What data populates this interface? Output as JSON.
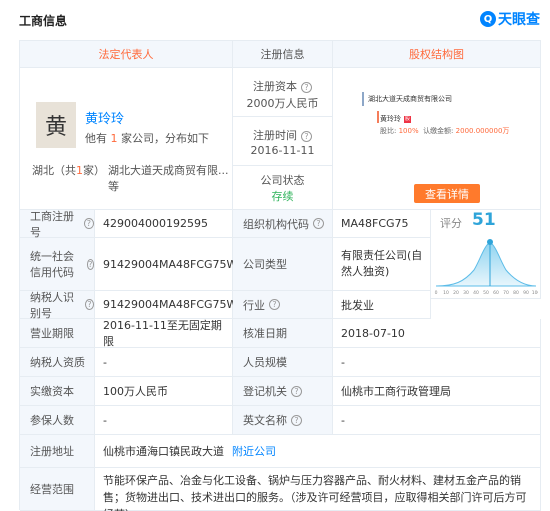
{
  "header": {
    "title": "工商信息",
    "logo_text": "天眼查",
    "logo_badge": "Q"
  },
  "columns": {
    "legal_rep": "法定代表人",
    "registration": "注册信息",
    "equity": "股权结构图"
  },
  "legal_rep": {
    "avatar_char": "黄",
    "name": "黄玲玲",
    "sub_prefix": "他有",
    "sub_count": "1",
    "sub_suffix": "家公司，分布如下",
    "province": "湖北",
    "province_prefix": "（共",
    "province_count": "1",
    "province_suffix": "家）",
    "companies": "湖北大道天成商贸有限...等"
  },
  "registration": {
    "capital_label": "注册资本",
    "capital_value": "2000万人民币",
    "time_label": "注册时间",
    "time_value": "2016-11-11",
    "status_label": "公司状态",
    "status_value": "存续"
  },
  "equity": {
    "company": "湖北大道天成商贸有限公司",
    "person": "黄玲玲",
    "person_mark": "股",
    "ratio_label": "股比:",
    "ratio_value": "100%",
    "amount_label": "认缴金额:",
    "amount_value": "2000.000000万",
    "button": "查看详情"
  },
  "score": {
    "label": "评分",
    "value": "51",
    "ticks": [
      "0",
      "10",
      "20",
      "30",
      "40",
      "50",
      "60",
      "70",
      "80",
      "90",
      "100"
    ]
  },
  "rows": [
    {
      "l1": "工商注册号",
      "q1": true,
      "v1": "429004000192595",
      "l2": "组织机构代码",
      "q2": true,
      "v2": "MA48FCG75"
    },
    {
      "l1": "统一社会信用代码",
      "q1": true,
      "v1": "91429004MA48FCG75W",
      "l2": "公司类型",
      "q2": false,
      "v2": "有限责任公司(自然人独资)"
    },
    {
      "l1": "纳税人识别号",
      "q1": true,
      "v1": "91429004MA48FCG75W",
      "l2": "行业",
      "q2": true,
      "v2": "批发业"
    },
    {
      "l1": "营业期限",
      "q1": false,
      "v1": "2016-11-11至无固定期限",
      "l2": "核准日期",
      "q2": false,
      "v2": "2018-07-10"
    },
    {
      "l1": "纳税人资质",
      "q1": false,
      "v1": "-",
      "l2": "人员规模",
      "q2": false,
      "v2": "-"
    },
    {
      "l1": "实缴资本",
      "q1": false,
      "v1": "100万人民币",
      "l2": "登记机关",
      "q2": true,
      "v2": "仙桃市工商行政管理局"
    },
    {
      "l1": "参保人数",
      "q1": false,
      "v1": "-",
      "l2": "英文名称",
      "q2": true,
      "v2": "-"
    }
  ],
  "address": {
    "label": "注册地址",
    "value": "仙桃市通海口镇民政大道",
    "link": "附近公司"
  },
  "scope": {
    "label": "经营范围",
    "value": "节能环保产品、冶金与化工设备、锅炉与压力容器产品、耐火材料、建材五金产品的销售；货物进出口、技术进出口的服务。（涉及许可经营项目，应取得相关部门许可后方可经营）"
  }
}
